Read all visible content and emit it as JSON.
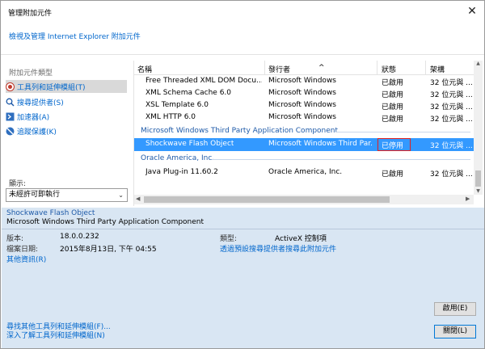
{
  "window": {
    "title": "管理附加元件",
    "close_glyph": "✕"
  },
  "subheader_link": "檢視及管理 Internet Explorer 附加元件",
  "left": {
    "title": "附加元件類型",
    "categories": [
      {
        "label": "工具列和延伸模組(T)",
        "icon": "toolbar-icon",
        "selected": true
      },
      {
        "label": "搜尋提供者(S)",
        "icon": "search-icon",
        "selected": false
      },
      {
        "label": "加速器(A)",
        "icon": "accelerator-icon",
        "selected": false
      },
      {
        "label": "追蹤保護(K)",
        "icon": "tracking-protection-icon",
        "selected": false
      }
    ],
    "show_label": "顯示:",
    "show_value": "未經許可即執行"
  },
  "list": {
    "columns": [
      "名稱",
      "發行者",
      "狀態",
      "架構"
    ],
    "rows_top": [
      {
        "name": "Free Threaded XML DOM Docu...",
        "publisher": "Microsoft Windows",
        "status": "已啟用",
        "arch": "32 位元與 ..."
      },
      {
        "name": "XML Schema Cache 6.0",
        "publisher": "Microsoft Windows",
        "status": "已啟用",
        "arch": "32 位元與 ..."
      },
      {
        "name": "XSL Template 6.0",
        "publisher": "Microsoft Windows",
        "status": "已啟用",
        "arch": "32 位元與 ..."
      },
      {
        "name": "XML HTTP 6.0",
        "publisher": "Microsoft Windows",
        "status": "已啟用",
        "arch": "32 位元與 ..."
      }
    ],
    "group1": "Microsoft Windows Third Party Application Component",
    "selected_row": {
      "name": "Shockwave Flash Object",
      "publisher": "Microsoft Windows Third Par...",
      "status": "已停用",
      "arch": "32 位元與 ..."
    },
    "group2": "Oracle America, Inc.",
    "oracle_row": {
      "name": "Java Plug-in 11.60.2",
      "publisher": "Oracle America, Inc.",
      "status": "已啟用",
      "arch": "32 位元與 ..."
    }
  },
  "details": {
    "name": "Shockwave Flash Object",
    "publisher": "Microsoft Windows Third Party Application Component",
    "version_label": "版本:",
    "version_value": "18.0.0.232",
    "date_label": "檔案日期:",
    "date_value": "2015年8月13日, 下午 04:55",
    "more_info": "其他資訊(R)",
    "type_label": "類型:",
    "type_value": "ActiveX 控制項",
    "search_link": "透過預設搜尋提供者搜尋此附加元件",
    "enable_button": "啟用(E)",
    "find_more": "尋找其他工具列和延伸模組(F)...",
    "learn_more": "深入了解工具列和延伸模組(N)",
    "close_button": "關閉(L)"
  },
  "colors": {
    "link": "#0066cc",
    "selection": "#3399ff",
    "details_bg": "#d9e6f3",
    "disabled_box": "#e02020"
  }
}
